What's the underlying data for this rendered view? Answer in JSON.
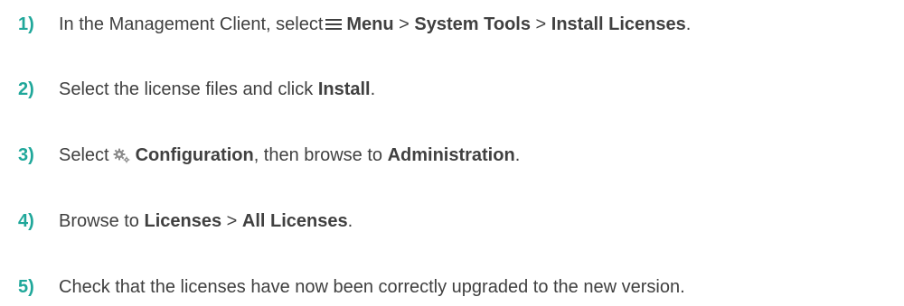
{
  "steps": [
    {
      "number": "1)",
      "parts": {
        "t1": "In the Management Client, select",
        "icon": "menu-icon",
        "b1": "Menu",
        "t2": " > ",
        "b2": "System Tools",
        "t3": " > ",
        "b3": "Install Licenses",
        "t4": "."
      }
    },
    {
      "number": "2)",
      "parts": {
        "t1": "Select the license files and click ",
        "b1": "Install",
        "t2": "."
      }
    },
    {
      "number": "3)",
      "parts": {
        "t1": "Select",
        "icon": "gear-icon",
        "b1": "Configuration",
        "t2": ", then browse to ",
        "b2": "Administration",
        "t3": "."
      }
    },
    {
      "number": "4)",
      "parts": {
        "t1": "Browse to ",
        "b1": "Licenses",
        "t2": " > ",
        "b2": "All Licenses",
        "t3": "."
      }
    },
    {
      "number": "5)",
      "parts": {
        "t1": "Check that the licenses have now been correctly upgraded to the new version."
      }
    }
  ],
  "colors": {
    "step_number": "#1fa79a",
    "text": "#404040",
    "icon": "#8a8a8a"
  }
}
